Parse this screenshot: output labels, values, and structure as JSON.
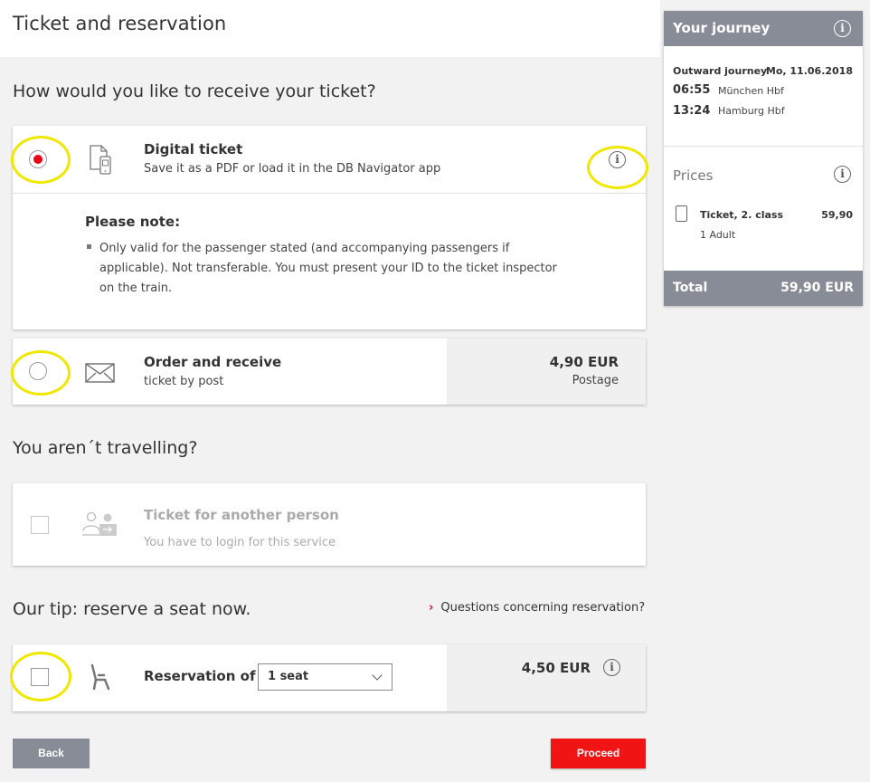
{
  "page": {
    "title": "Ticket and reservation"
  },
  "receive": {
    "heading": "How would you like to receive your ticket?",
    "digital": {
      "title": "Digital ticket",
      "subtitle": "Save it as a PDF or load it in the DB Navigator app",
      "info_icon": "info-icon",
      "selected": true
    },
    "note": {
      "title": "Please note:",
      "text": "Only valid for the passenger stated (and accompanying passengers if applicable). Not transferable. You must present your ID to the ticket inspector on the train."
    },
    "post": {
      "title": "Order and receive",
      "subtitle": "ticket by post",
      "price": "4,90 EUR",
      "price_label": "Postage",
      "selected": false
    }
  },
  "not_travelling": {
    "heading": "You aren´t travelling?",
    "other_person": {
      "title": "Ticket for another person",
      "subtitle": "You have to login for this service"
    }
  },
  "reservation": {
    "heading": "Our tip: reserve a seat now.",
    "questions_link": "Questions concerning reservation?",
    "label": "Reservation of",
    "seat_select": "1 seat",
    "price": "4,50 EUR"
  },
  "buttons": {
    "back": "Back",
    "proceed": "Proceed"
  },
  "sidebar": {
    "title": "Your journey",
    "outward_label": "Outward journey",
    "outward_date": "Mo, 11.06.2018",
    "departure_time": "06:55",
    "departure_station": "München Hbf",
    "arrival_time": "13:24",
    "arrival_station": "Hamburg Hbf",
    "prices_label": "Prices",
    "ticket_label": "Ticket, 2. class",
    "ticket_price": "59,90",
    "passengers": "1 Adult",
    "total_label": "Total",
    "total_value": "59,90 EUR"
  },
  "colors": {
    "accent_red": "#ec0016",
    "header_grey": "#878c96",
    "highlight_yellow": "#f0e800"
  }
}
